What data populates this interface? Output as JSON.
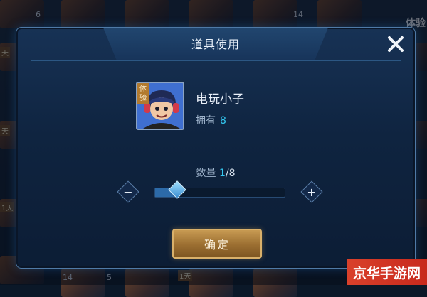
{
  "background": {
    "numbers": [
      "6",
      "14",
      "14",
      "5"
    ],
    "tags": [
      "天",
      "天",
      "1天",
      "1天"
    ],
    "side_text": "体验"
  },
  "dialog": {
    "title": "道具使用",
    "item": {
      "name": "电玩小子",
      "trial_tag": "体验",
      "owned_label": "拥有",
      "owned_count": "8"
    },
    "quantity": {
      "label": "数量",
      "current": "1",
      "max": "/8",
      "fraction": 0.125
    },
    "minus_symbol": "−",
    "plus_symbol": "+",
    "confirm_label": "确定",
    "close_icon": "close-icon"
  },
  "watermark": "京华手游网",
  "colors": {
    "accent_cyan": "#33c7ef",
    "confirm_gold": "#c79a52",
    "watermark_red": "#d9412b"
  }
}
